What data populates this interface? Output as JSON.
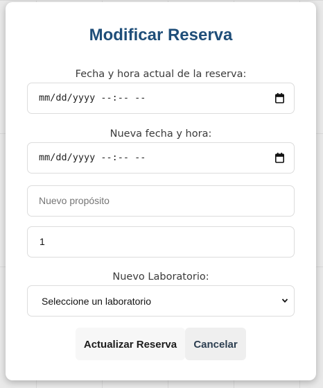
{
  "modal": {
    "title": "Modificar Reserva"
  },
  "current_datetime": {
    "label": "Fecha y hora actual de la reserva:",
    "value": "mm/dd/yyyy --:-- --",
    "icon": "calendar-icon"
  },
  "new_datetime": {
    "label": "Nueva fecha y hora:",
    "value": "mm/dd/yyyy --:-- --",
    "icon": "calendar-icon"
  },
  "purpose": {
    "placeholder": "Nuevo propósito",
    "value": ""
  },
  "quantity": {
    "value": "1"
  },
  "laboratory": {
    "label": "Nuevo Laboratorio:",
    "selected": "Seleccione un laboratorio",
    "icon": "chevron-down-icon"
  },
  "buttons": {
    "update_label": "Actualizar Reserva",
    "cancel_label": "Cancelar"
  },
  "colors": {
    "title": "#1f4e79",
    "backdrop": "#e9e9e9",
    "primary_button_bg": "#f7f7f7",
    "secondary_button_bg": "#efefef"
  }
}
